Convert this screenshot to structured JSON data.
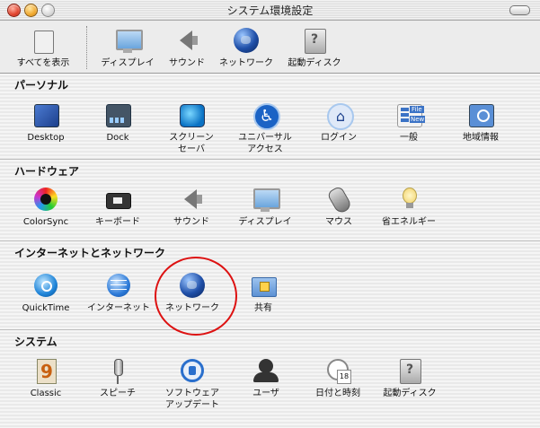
{
  "window": {
    "title": "システム環境設定"
  },
  "toolbar": {
    "items": [
      {
        "label": "すべてを表示",
        "icon": "apple-icon"
      },
      {
        "label": "ディスプレイ",
        "icon": "monitor-icon"
      },
      {
        "label": "サウンド",
        "icon": "speaker-icon"
      },
      {
        "label": "ネットワーク",
        "icon": "globe-icon"
      },
      {
        "label": "起動ディスク",
        "icon": "startup-disk-icon"
      }
    ]
  },
  "sections": [
    {
      "title": "パーソナル",
      "items": [
        {
          "label": "Desktop"
        },
        {
          "label": "Dock"
        },
        {
          "label": "スクリーン",
          "label2": "セーバ"
        },
        {
          "label": "ユニバーサル",
          "label2": "アクセス"
        },
        {
          "label": "ログイン"
        },
        {
          "label": "一般"
        },
        {
          "label": "地域情報"
        }
      ]
    },
    {
      "title": "ハードウェア",
      "items": [
        {
          "label": "ColorSync"
        },
        {
          "label": "キーボード"
        },
        {
          "label": "サウンド"
        },
        {
          "label": "ディスプレイ"
        },
        {
          "label": "マウス"
        },
        {
          "label": "省エネルギー"
        }
      ]
    },
    {
      "title": "インターネットとネットワーク",
      "items": [
        {
          "label": "QuickTime"
        },
        {
          "label": "インターネット"
        },
        {
          "label": "ネットワーク"
        },
        {
          "label": "共有"
        }
      ]
    },
    {
      "title": "システム",
      "items": [
        {
          "label": "Classic"
        },
        {
          "label": "スピーチ"
        },
        {
          "label": "ソフトウェア",
          "label2": "アップデート"
        },
        {
          "label": "ユーザ"
        },
        {
          "label": "日付と時刻"
        },
        {
          "label": "起動ディスク"
        }
      ]
    }
  ],
  "misc": {
    "general_file_text": "File",
    "general_new_text": "New",
    "classic_glyph": "9",
    "apple_glyph": "",
    "calendar_day": "18",
    "universal_glyph": "♿",
    "login_glyph": "⌂",
    "highlight_color": "#dd1111"
  }
}
